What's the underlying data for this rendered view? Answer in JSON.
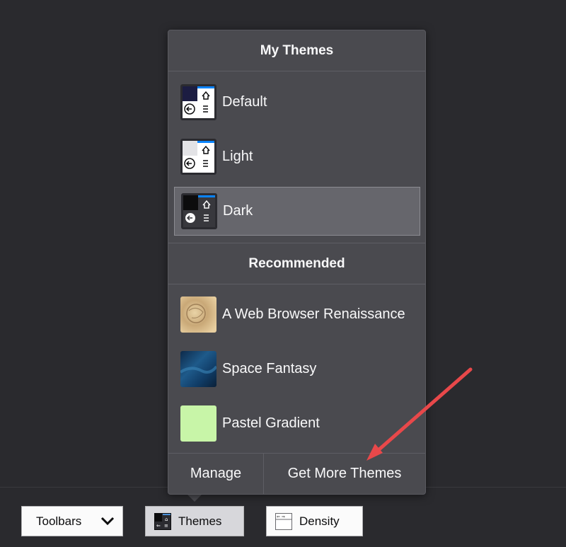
{
  "popup": {
    "my_themes_header": "My Themes",
    "recommended_header": "Recommended",
    "my_themes": [
      {
        "label": "Default",
        "icon": "theme-default-icon",
        "selected": false
      },
      {
        "label": "Light",
        "icon": "theme-light-icon",
        "selected": false
      },
      {
        "label": "Dark",
        "icon": "theme-dark-icon",
        "selected": true
      }
    ],
    "recommended": [
      {
        "label": "A Web Browser Renaissance",
        "icon": "renaissance-thumbnail"
      },
      {
        "label": "Space Fantasy",
        "icon": "space-fantasy-thumbnail"
      },
      {
        "label": "Pastel Gradient",
        "icon": "pastel-gradient-thumbnail"
      }
    ],
    "manage_label": "Manage",
    "get_more_label": "Get More Themes"
  },
  "toolbar": {
    "toolbars_label": "Toolbars",
    "themes_label": "Themes",
    "density_label": "Density"
  },
  "colors": {
    "background": "#2a2a2e",
    "popup_bg": "#4a4a4f",
    "selected_bg": "#66666c",
    "annotation_arrow": "#e8484a"
  }
}
